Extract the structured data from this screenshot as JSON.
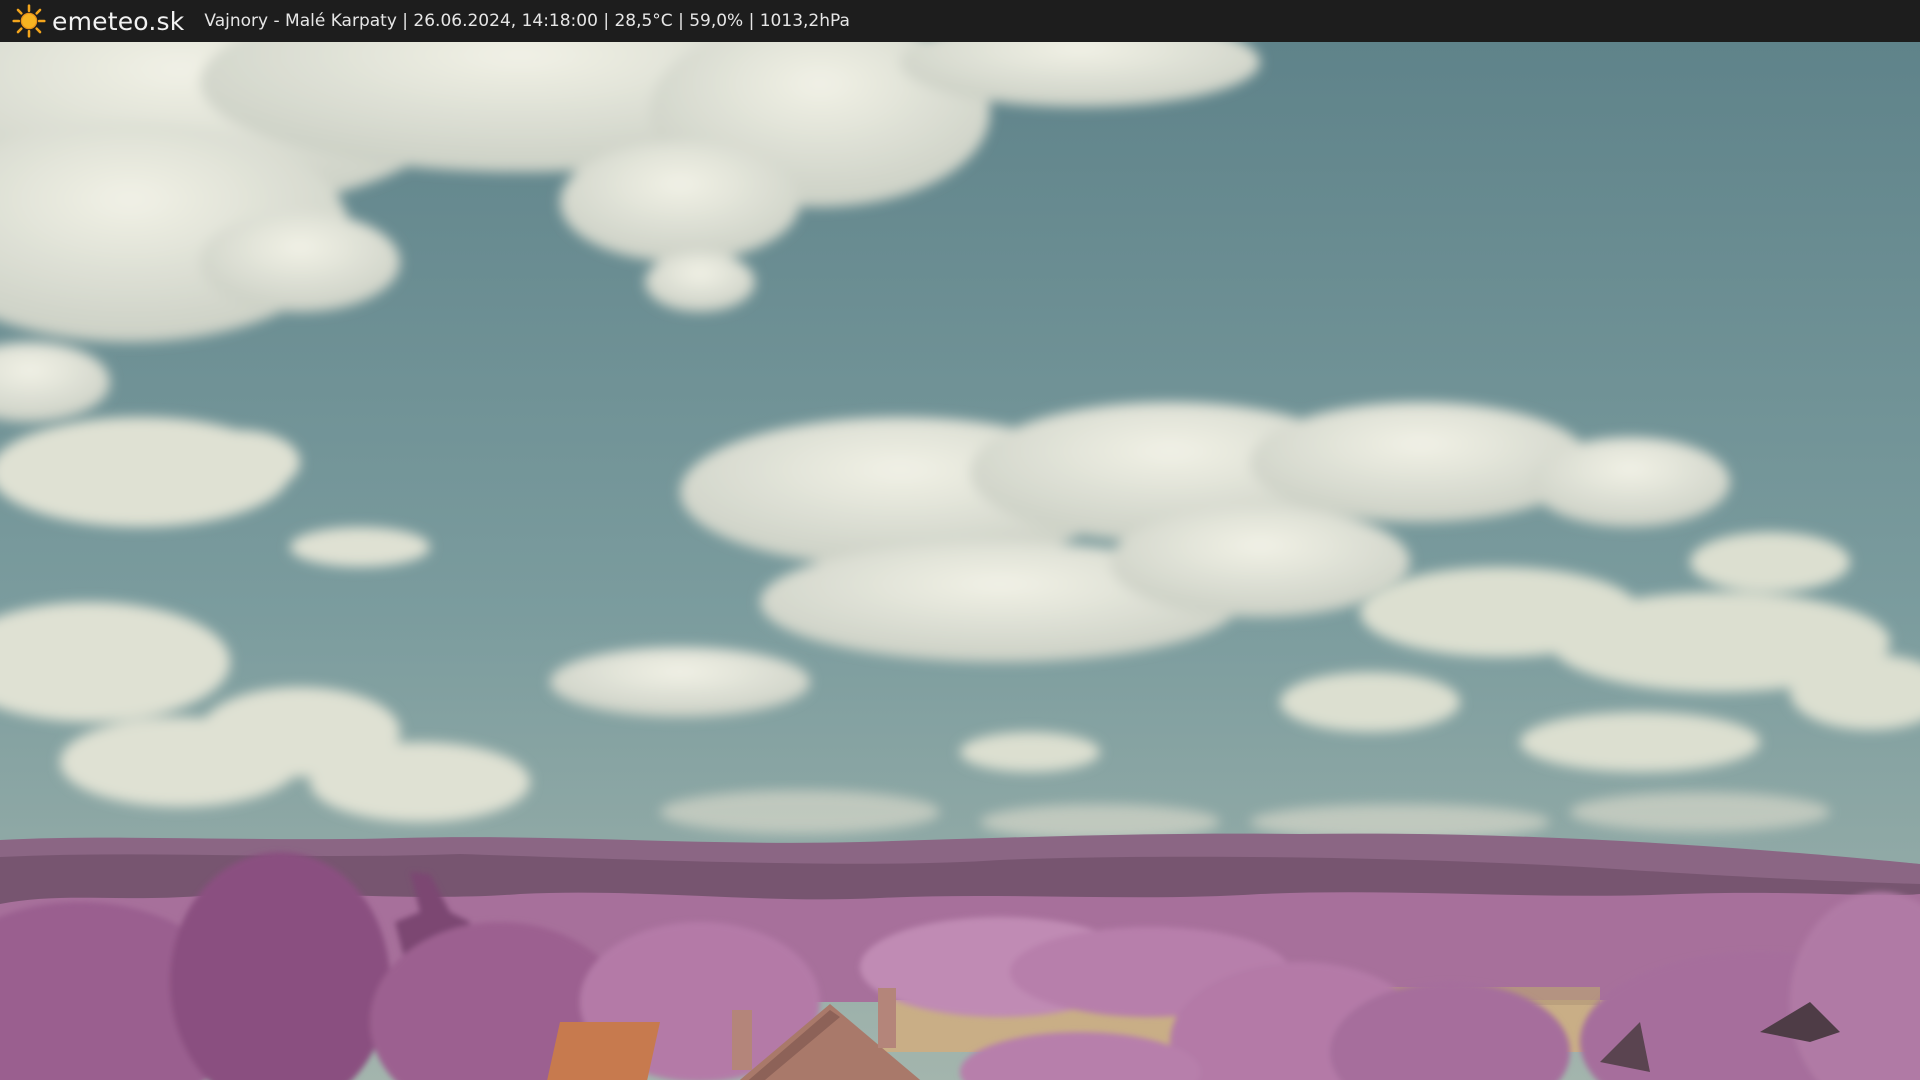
{
  "header": {
    "logo_icon": "sun-icon",
    "logo_text": "emeteo.sk",
    "caption": "Vajnory - Malé Karpaty | 26.06.2024, 14:18:00 | 28,5°C | 59,0% | 1013,2hPa"
  },
  "colors": {
    "sky_top": "#5f838a",
    "sky_bottom": "#8aa8aa",
    "cloud": "#e8eadb",
    "hills": "#7f5a77",
    "foliage": "#b47aa7",
    "field": "#c7ad86",
    "roof": "#c77a4e"
  }
}
